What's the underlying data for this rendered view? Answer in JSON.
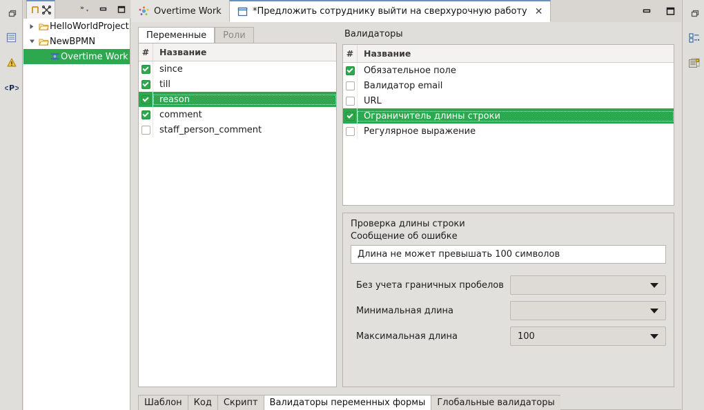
{
  "left_rail": {
    "items": [
      {
        "name": "restore-view-icon",
        "title": "Restore"
      },
      {
        "name": "project-explorer-icon",
        "title": "Project Explorer"
      },
      {
        "name": "warnings-icon",
        "title": "Warnings"
      },
      {
        "name": "code-snippets-icon",
        "title": "Code"
      }
    ]
  },
  "right_rail": {
    "items": [
      {
        "name": "restore-view-icon",
        "title": "Restore"
      },
      {
        "name": "outline-icon",
        "title": "Outline"
      },
      {
        "name": "properties-icon",
        "title": "Properties"
      }
    ]
  },
  "explorer": {
    "tab_icons": [
      "process-explorer-icon",
      "bot-stations-icon"
    ],
    "toolbar_icons": [
      "view-menu-icon",
      "minimize-icon",
      "maximize-icon"
    ],
    "tree": [
      {
        "label": "HelloWorldProject",
        "icon": "folder-icon",
        "expanded": false,
        "selected": false,
        "indent": 0
      },
      {
        "label": "NewBPMN",
        "icon": "folder-icon",
        "expanded": true,
        "selected": false,
        "indent": 0
      },
      {
        "label": "Overtime Work",
        "icon": "process-icon",
        "expanded": null,
        "selected": true,
        "indent": 1
      }
    ]
  },
  "editor": {
    "tabs": [
      {
        "label": "Overtime Work",
        "icon": "process-icon",
        "active": false,
        "closable": false
      },
      {
        "label": "*Предложить сотруднику выйти на сверхурочную работу",
        "icon": "form-icon",
        "active": true,
        "closable": true,
        "close_glyph": "✕"
      }
    ],
    "window_buttons": [
      "minimize-icon",
      "maximize-icon"
    ]
  },
  "variables_panel": {
    "tabs": [
      {
        "label": "Переменные",
        "active": true
      },
      {
        "label": "Роли",
        "active": false
      }
    ],
    "columns": [
      "#",
      "Название"
    ],
    "rows": [
      {
        "name": "since",
        "checked": true,
        "selected": false
      },
      {
        "name": "till",
        "checked": true,
        "selected": false
      },
      {
        "name": "reason",
        "checked": true,
        "selected": true
      },
      {
        "name": "comment",
        "checked": true,
        "selected": false
      },
      {
        "name": "staff_person_comment",
        "checked": false,
        "selected": false
      }
    ]
  },
  "validators_panel": {
    "title": "Валидаторы",
    "columns": [
      "#",
      "Название"
    ],
    "rows": [
      {
        "name": "Обязательное поле",
        "checked": true,
        "selected": false
      },
      {
        "name": "Валидатор email",
        "checked": false,
        "selected": false
      },
      {
        "name": "URL",
        "checked": false,
        "selected": false
      },
      {
        "name": "Ограничитель длины строки",
        "checked": true,
        "selected": true
      },
      {
        "name": "Регулярное выражение",
        "checked": false,
        "selected": false
      }
    ]
  },
  "details": {
    "heading": "Проверка длины строки",
    "message_label": "Сообщение об ошибке",
    "message_value": "Длина не может превышать 100 символов",
    "fields": [
      {
        "label": "Без учета граничных пробелов",
        "value": ""
      },
      {
        "label": "Минимальная длина",
        "value": ""
      },
      {
        "label": "Максимальная длина",
        "value": "100"
      }
    ]
  },
  "bottom_tabs": [
    {
      "label": "Шаблон",
      "active": false
    },
    {
      "label": "Код",
      "active": false
    },
    {
      "label": "Скрипт",
      "active": false
    },
    {
      "label": "Валидаторы переменных формы",
      "active": true
    },
    {
      "label": "Глобальные валидаторы",
      "active": false
    }
  ],
  "colors": {
    "selection_green": "#2ea84f",
    "panel_bg": "#e0dedb",
    "table_bg": "#ffffff",
    "border": "#b6b3ae",
    "tab_accent": "#6a8fbd"
  }
}
